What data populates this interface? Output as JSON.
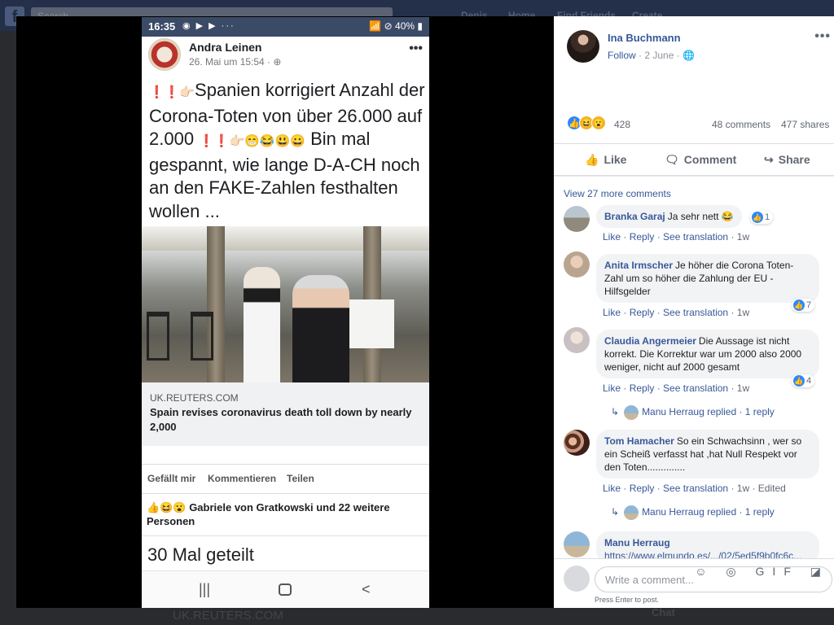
{
  "background": {
    "search_placeholder": "Search",
    "nav": [
      "Denis",
      "Home",
      "Find Friends",
      "Create"
    ],
    "caption": "UK.REUTERS.COM",
    "chat_label": "Chat"
  },
  "phone": {
    "status": {
      "time": "16:35",
      "icons": "◉ ▶ ▶ ···",
      "right": "📶 ⊘ 40% ▮"
    },
    "post": {
      "author": "Andra Leinen",
      "time": "26. Mai um 15:54 · ⊕",
      "more": "•••",
      "emoji_lead": "❗❗👉🏻",
      "text_main": "Spanien korrigiert Anzahl der Corona-Toten von über 26.000 auf 2.000",
      "emoji_mid": "❗❗👉🏻😁😂😃😀",
      "text_tail": "Bin mal gespannt, wie lange D-A-CH noch an den FAKE-Zahlen festhalten wollen ...",
      "link_domain": "UK.REUTERS.COM",
      "link_title": "Spain revises coronavirus death toll down by nearly 2,000"
    },
    "actions": [
      "Gefällt mir",
      "Kommentieren",
      "Teilen"
    ],
    "reaction_text": "Gabriele von Gratkowski und 22 weitere Personen",
    "reaction_icons": "👍😆😮",
    "shares": "30 Mal geteilt",
    "nav_recent": "|||",
    "nav_back": "<"
  },
  "panel": {
    "name": "Ina Buchmann",
    "follow": "Follow",
    "date": "· 2 June · 🌐",
    "more": "•••",
    "reaction_count": "428",
    "comments_count": "48 comments",
    "shares_count": "477 shares",
    "actions": {
      "like": "Like",
      "comment": "Comment",
      "share": "Share"
    },
    "view_more": "View 27 more comments",
    "comment_labels": {
      "like": "Like",
      "reply": "Reply",
      "translate": "See translation"
    },
    "comments": [
      {
        "name": "Branka Garaj",
        "text": "Ja sehr nett 😂",
        "time": "1w",
        "likes": "1"
      },
      {
        "name": "Anita Irmscher",
        "text": "Je höher die Corona Toten-Zahl um so höher die Zahlung der EU - Hilfsgelder",
        "time": "1w",
        "likes": "7"
      },
      {
        "name": "Claudia Angermeier",
        "text": "Die Aussage ist nicht korrekt. Die Korrektur war um 2000 also 2000 weniger, nicht auf 2000 gesamt",
        "time": "1w",
        "likes": "4",
        "reply_by": "Manu Herraug replied · 1 reply"
      },
      {
        "name": "Tom Hamacher",
        "text": "So ein Schwachsinn , wer so ein Scheiß verfasst hat ,hat Null Respekt vor den Toten..............",
        "time": "1w",
        "edited": "Edited",
        "reply_by": "Manu Herraug replied · 1 reply"
      },
      {
        "name": "Manu Herraug",
        "text": "https://www.elmundo.es/.../02/5ed5f9b0fc6c..."
      }
    ],
    "write_placeholder": "Write a comment...",
    "write_hint": "Press Enter to post.",
    "write_icons": "☺ ◎ GIF ◪"
  }
}
